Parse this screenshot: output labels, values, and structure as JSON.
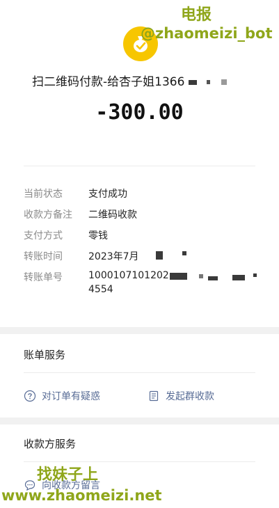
{
  "watermark": {
    "top_label": "电报",
    "top_handle": "@zhaomeizi_bot",
    "bottom_label": "找妹子上",
    "bottom_url": "www.zhaomeizi.net"
  },
  "payment": {
    "merchant": "扫二维码付款-给杏子姐1366",
    "amount": "-300.00"
  },
  "details": [
    {
      "key": "当前状态",
      "value": "支付成功"
    },
    {
      "key": "收款方备注",
      "value": "二维码收款"
    },
    {
      "key": "支付方式",
      "value": "零钱"
    },
    {
      "key": "转账时间",
      "value": "2023年7月"
    },
    {
      "key": "转账单号",
      "value": "1000107101202",
      "value2": "4554"
    }
  ],
  "bill_service": {
    "title": "账单服务",
    "actions": [
      {
        "label": "对订单有疑惑",
        "icon": "question-circle-icon"
      },
      {
        "label": "发起群收款",
        "icon": "document-icon"
      }
    ]
  },
  "payee_service": {
    "title": "收款方服务",
    "actions": [
      {
        "label": "向收款方留言",
        "icon": "chat-bubble-icon"
      }
    ]
  },
  "colors": {
    "coin": "#f7c600",
    "link": "#576b95",
    "watermark": "#8fa61a"
  }
}
